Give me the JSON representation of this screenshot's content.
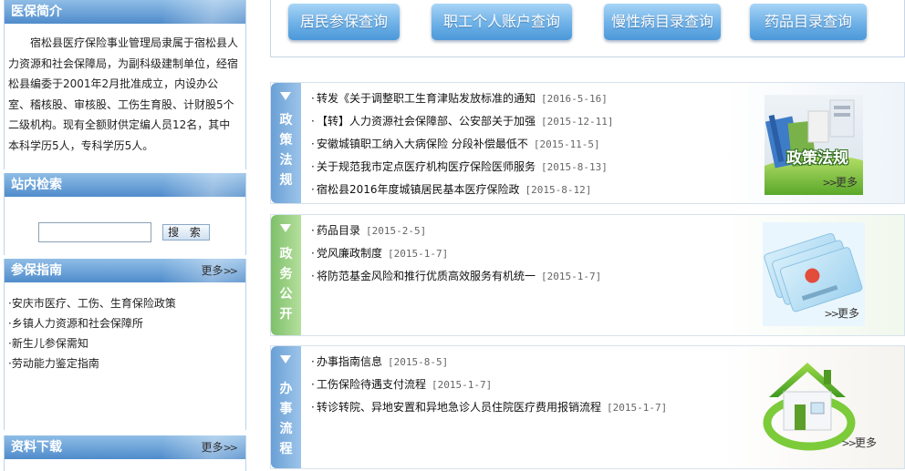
{
  "sidebar": {
    "intro": {
      "title": "医保简介",
      "text": "宿松县医疗保险事业管理局隶属于宿松县人力资源和社会保障局，为副科级建制单位，经宿松县编委于2001年2月批准成立，内设办公室、稽核股、审核股、工伤生育股、计财股5个二级机构。现有全额财供定编人员12名，其中本科学历5人，专科学历5人。"
    },
    "search": {
      "title": "站内检索",
      "input_value": "",
      "button_label": "搜 索"
    },
    "guide": {
      "title": "参保指南",
      "more": "更多",
      "items": [
        "安庆市医疗、工伤、生育保险政策",
        "乡镇人力资源和社会保障所",
        "新生儿参保需知",
        "劳动能力鉴定指南"
      ]
    },
    "download": {
      "title": "资料下载",
      "more": "更多"
    }
  },
  "query_buttons": [
    "居民参保查询",
    "职工个人账户查询",
    "慢性病目录查询",
    "药品目录查询"
  ],
  "sections": [
    {
      "tab": [
        "政",
        "策",
        "法",
        "规"
      ],
      "items": [
        {
          "title": "转发《关于调整职工生育津贴发放标准的通知",
          "date": "[2016-5-16]"
        },
        {
          "title": "【转】人力资源社会保障部、公安部关于加强",
          "date": "[2015-12-11]"
        },
        {
          "title": "安徽城镇职工纳入大病保险 分段补偿最低不",
          "date": "[2015-11-5]"
        },
        {
          "title": "关于规范我市定点医疗机构医疗保险医师服务",
          "date": "[2015-8-13]"
        },
        {
          "title": "宿松县2016年度城镇居民基本医疗保险政",
          "date": "[2015-8-12]"
        }
      ],
      "image_label": "政策法规",
      "more": "更多"
    },
    {
      "tab": [
        "政",
        "务",
        "公",
        "开"
      ],
      "items": [
        {
          "title": "药品目录",
          "date": "[2015-2-5]"
        },
        {
          "title": "党风廉政制度",
          "date": "[2015-1-7]"
        },
        {
          "title": "将防范基金风险和推行优质高效服务有机统一",
          "date": "[2015-1-7]"
        }
      ],
      "more": "更多"
    },
    {
      "tab": [
        "办",
        "事",
        "流",
        "程"
      ],
      "items": [
        {
          "title": "办事指南信息",
          "date": "[2015-8-5]"
        },
        {
          "title": "工伤保险待遇支付流程",
          "date": "[2015-1-7]"
        },
        {
          "title": "转诊转院、异地安置和异地急诊人员住院医疗费用报销流程",
          "date": "[2015-1-7]"
        }
      ],
      "more": "更多"
    }
  ],
  "colors": {
    "header_blue": "#4f8ccb",
    "tab_blue": "#6aa0d6",
    "tab_green": "#7ec06a",
    "button_blue": "#6eb1e7"
  }
}
